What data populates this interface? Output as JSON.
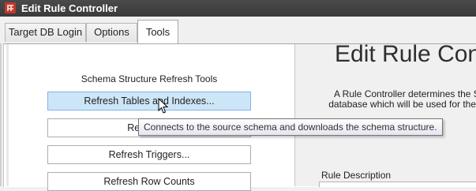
{
  "window": {
    "title": "Edit Rule Controller",
    "app_icon": "app-grid-icon"
  },
  "tabs": [
    {
      "label": "Target DB Login",
      "active": false
    },
    {
      "label": "Options",
      "active": false
    },
    {
      "label": "Tools",
      "active": true
    }
  ],
  "tools": {
    "section_title": "Schema Structure Refresh Tools",
    "buttons": [
      {
        "label": "Refresh Tables and Indexes...",
        "hover": true
      },
      {
        "label": "Refresh P",
        "hover": false
      },
      {
        "label": "Refresh Triggers...",
        "hover": false
      },
      {
        "label": "Refresh Row Counts",
        "hover": false
      }
    ],
    "tooltip": "Connects to the source schema and downloads the schema structure."
  },
  "right_pane": {
    "title": "Edit Rule Contr",
    "description_lines": [
      "A Rule Controller determines the S",
      "database which will be used for the"
    ],
    "rule_description_label": "Rule Description"
  },
  "colors": {
    "titlebar": "#3d3d3d",
    "button_hover": "#cde6f7",
    "tooltip_border": "#767676"
  },
  "cursor_icon": "mouse-pointer-icon"
}
